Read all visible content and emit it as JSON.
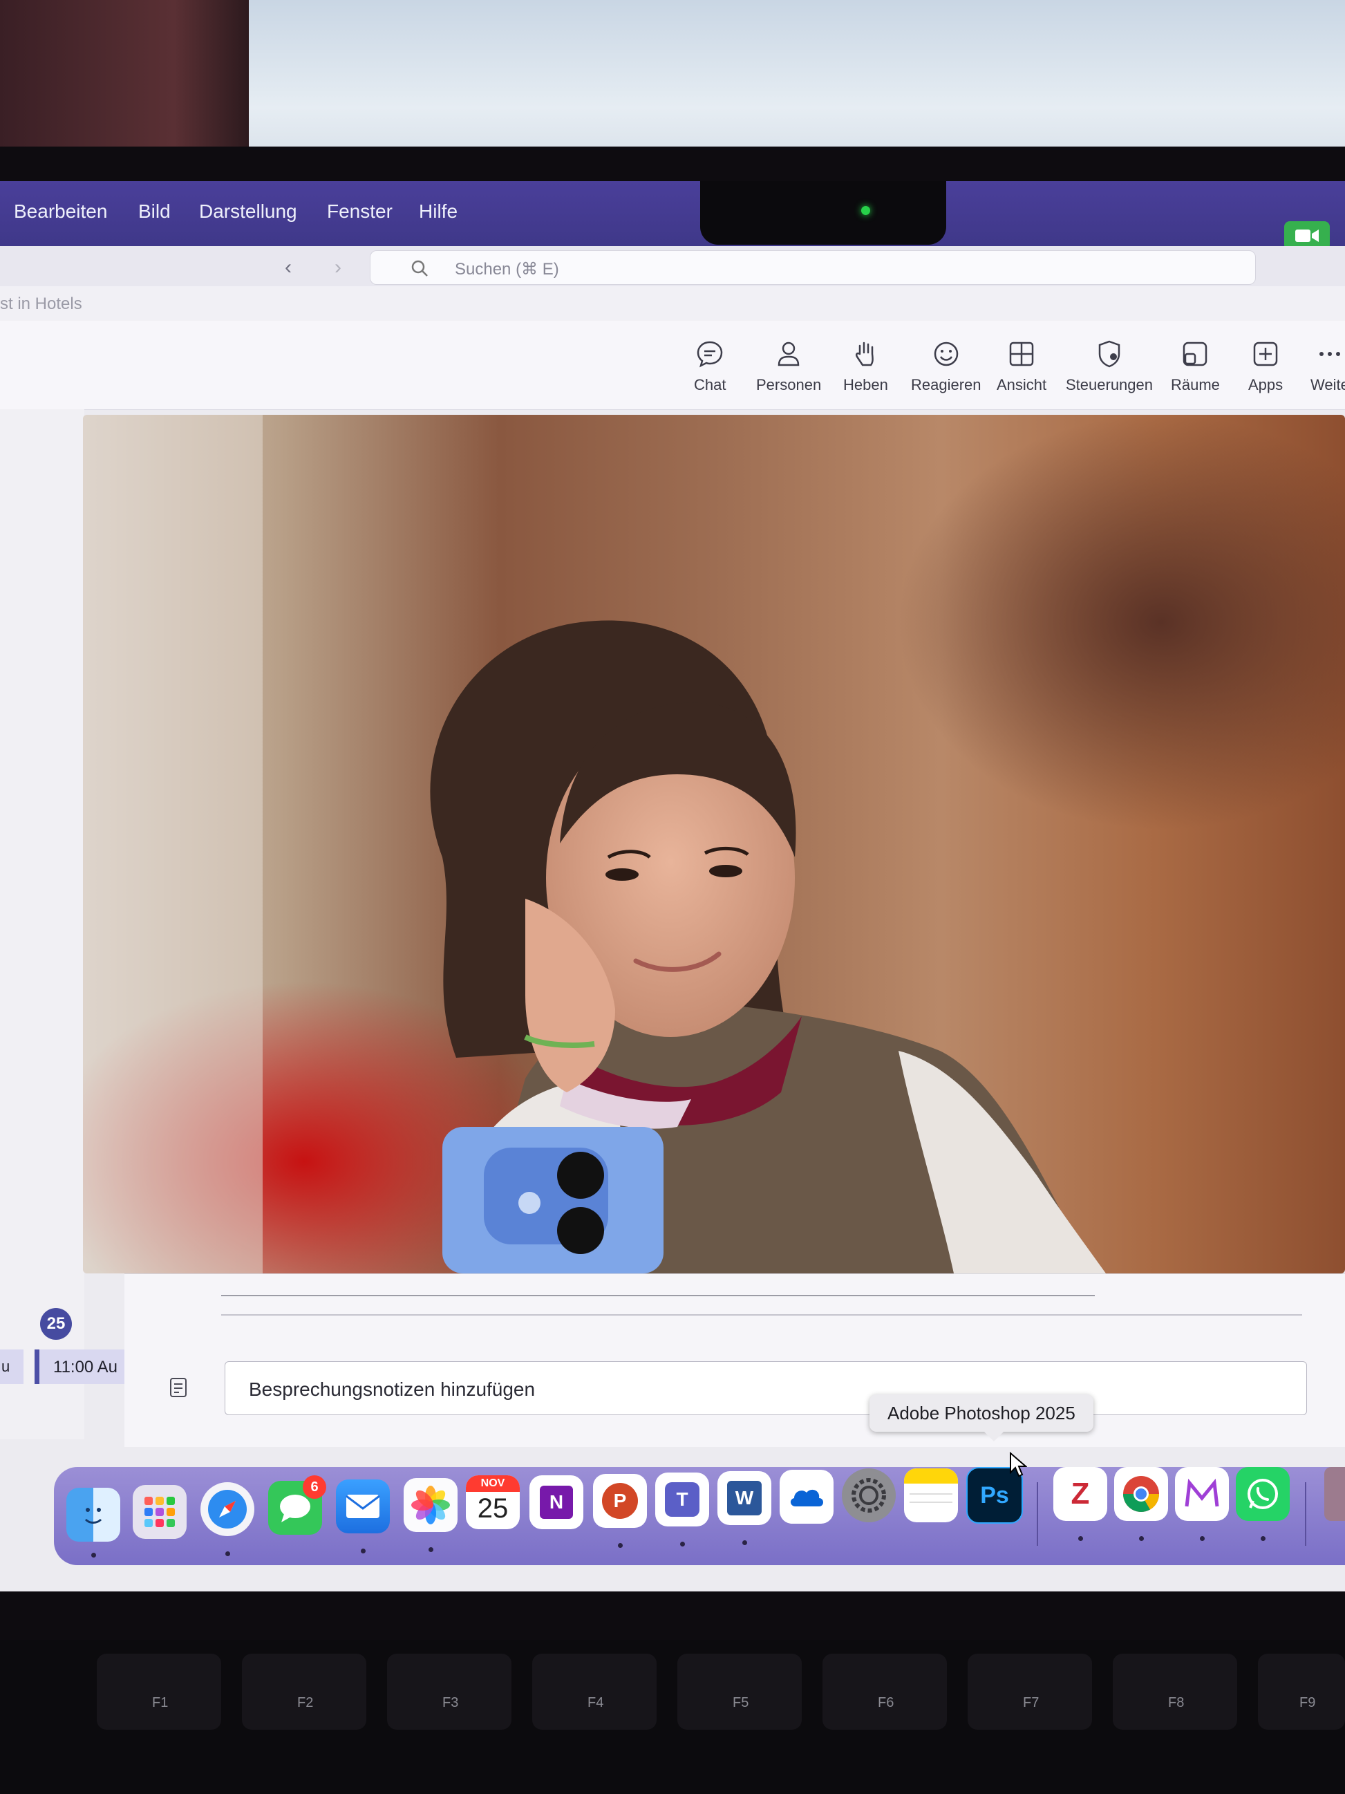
{
  "menubar": {
    "items": [
      "Bearbeiten",
      "Bild",
      "Darstellung",
      "Fenster",
      "Hilfe"
    ]
  },
  "search": {
    "placeholder": "Suchen (⌘ E)"
  },
  "meeting": {
    "title_fragment": "st in Hotels"
  },
  "toolbar": {
    "items": [
      {
        "label": "Chat",
        "icon": "chat-icon"
      },
      {
        "label": "Personen",
        "icon": "people-icon"
      },
      {
        "label": "Heben",
        "icon": "raise-hand-icon"
      },
      {
        "label": "Reagieren",
        "icon": "react-icon"
      },
      {
        "label": "Ansicht",
        "icon": "view-icon"
      },
      {
        "label": "Steuerungen",
        "icon": "controls-icon"
      },
      {
        "label": "Räume",
        "icon": "rooms-icon"
      },
      {
        "label": "Apps",
        "icon": "apps-icon"
      },
      {
        "label": "Weite",
        "icon": "more-icon"
      }
    ]
  },
  "calendar": {
    "date_badge": "25",
    "event_time": "11:00 Au",
    "event_left": "u"
  },
  "notes": {
    "placeholder": "Besprechungsnotizen hinzufügen"
  },
  "tooltip": {
    "text": "Adobe Photoshop 2025"
  },
  "dock": {
    "messages_badge": "6",
    "calendar_month": "NOV",
    "calendar_day": "25",
    "apps": [
      "Finder",
      "Launchpad",
      "Safari",
      "Messages",
      "Mail",
      "Photos",
      "Calendar",
      "OneNote",
      "PowerPoint",
      "Teams",
      "Word",
      "OneDrive",
      "System Settings",
      "Notes",
      "Adobe Photoshop 2025",
      "Zotero",
      "Chrome",
      "Mendeley",
      "WhatsApp"
    ]
  },
  "keyboard": {
    "keys": [
      "F1",
      "F2",
      "F3",
      "F4",
      "F5",
      "F6",
      "F7",
      "F8",
      "F9"
    ]
  },
  "colors": {
    "menubar": "#4a3f9a",
    "dock": "#8a7fcf",
    "teams_accent": "#464ba0",
    "camera_led": "#27d14a"
  }
}
